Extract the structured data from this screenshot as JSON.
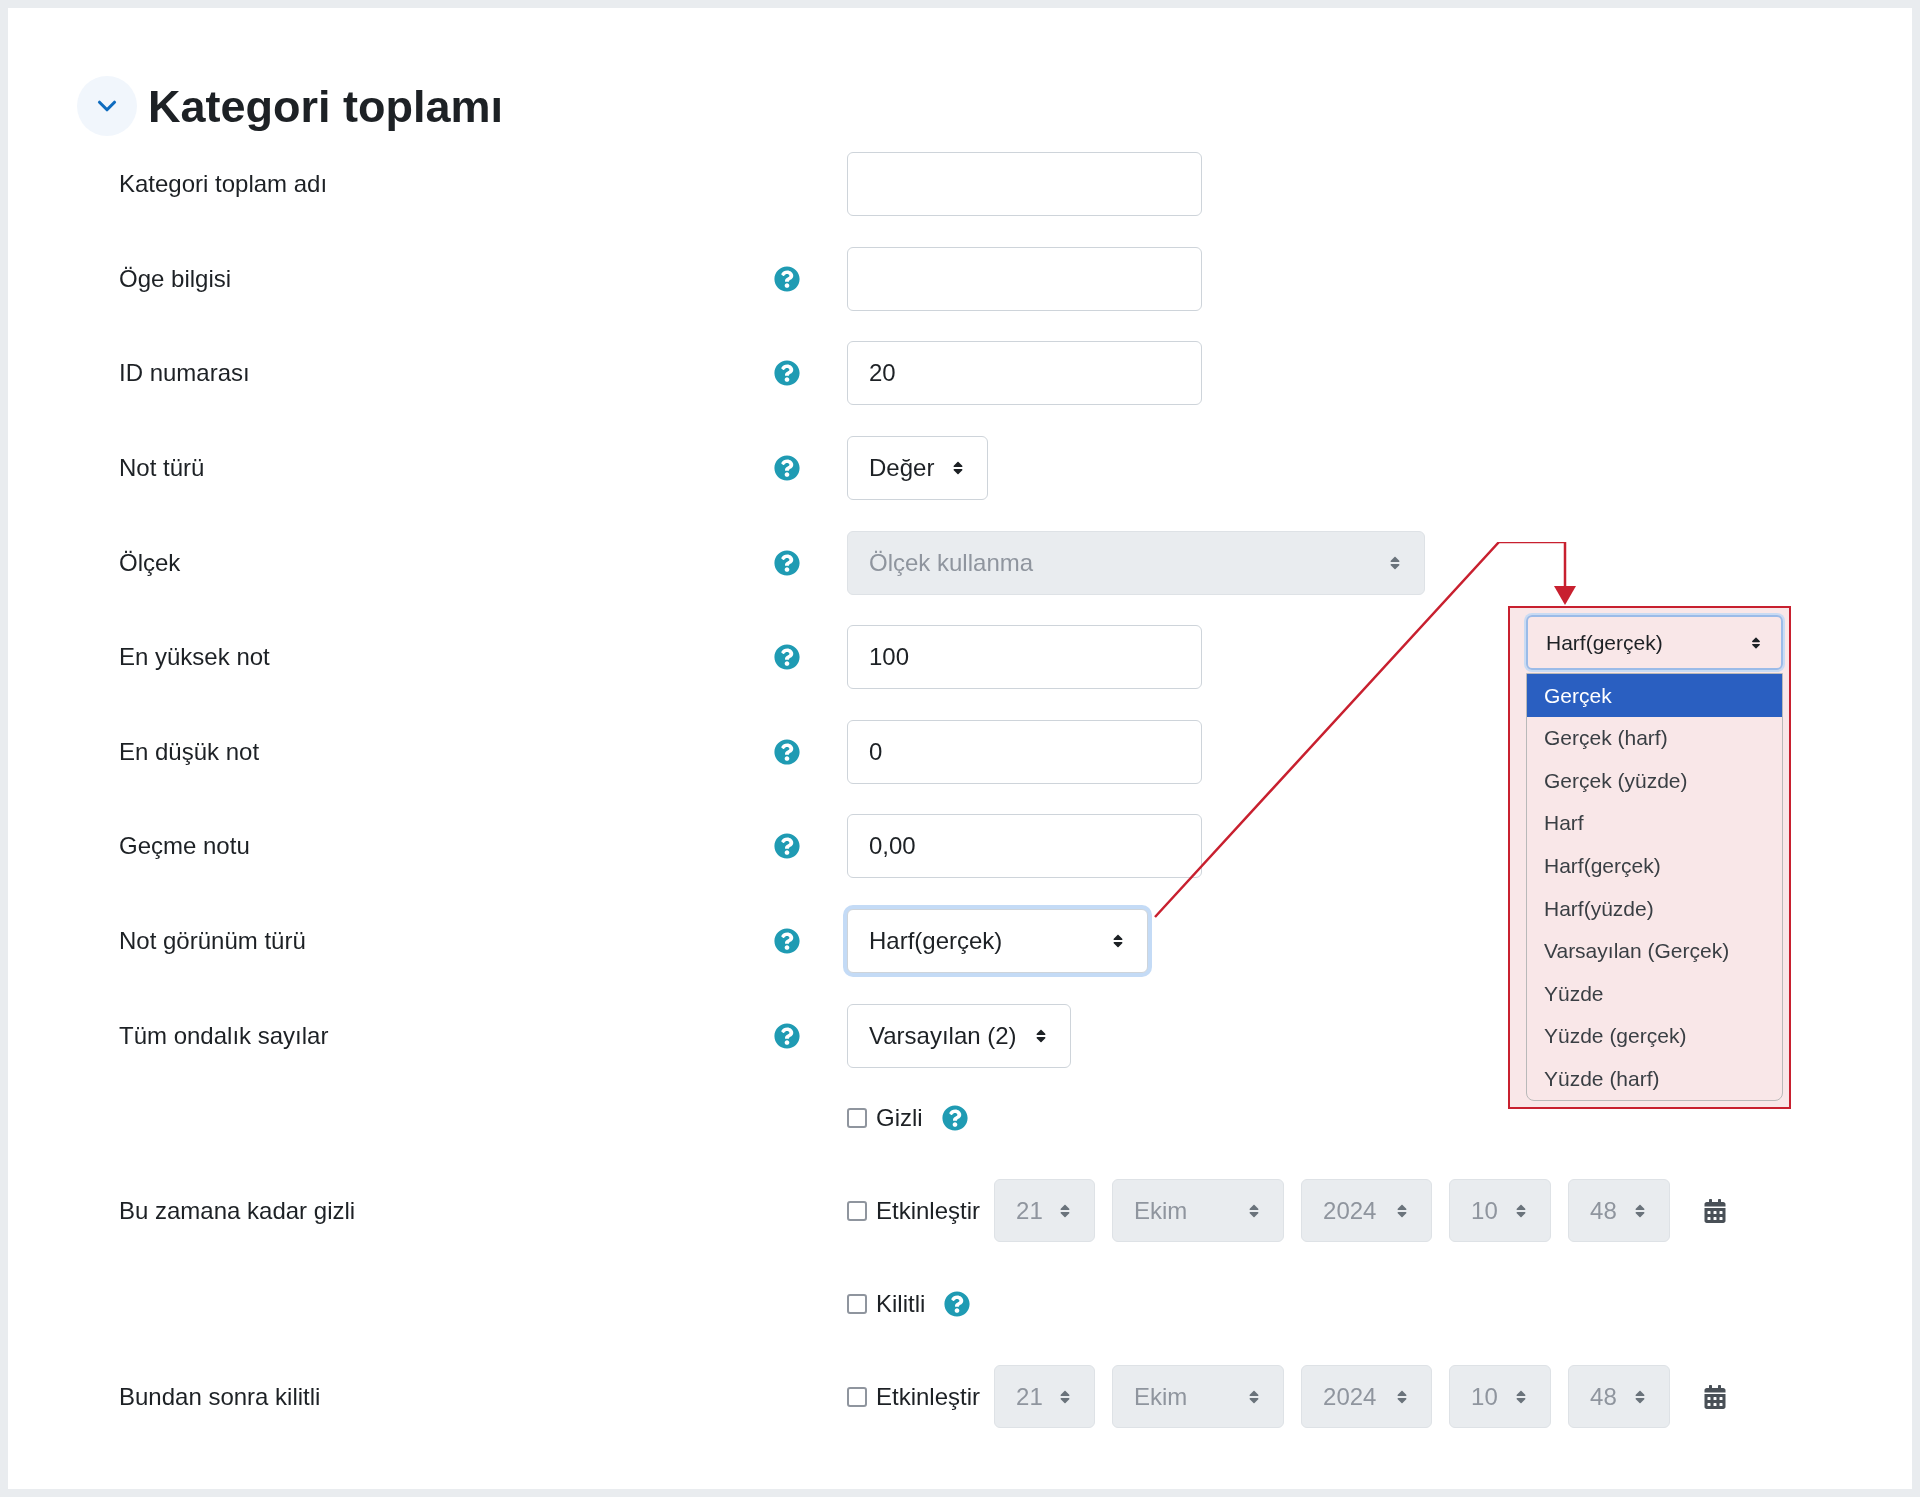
{
  "section": {
    "title": "Kategori toplamı",
    "expanded": true
  },
  "fields": [
    {
      "kind": "text",
      "label": "Kategori toplam adı",
      "help": false
    },
    {
      "kind": "text",
      "label": "Öge bilgisi",
      "help": true
    },
    {
      "kind": "text",
      "label": "ID numarası",
      "help": true,
      "value": "20"
    },
    {
      "kind": "select",
      "label": "Not türü",
      "help": true,
      "value": "Değer",
      "disabled": false,
      "focused": false
    },
    {
      "kind": "select",
      "label": "Ölçek",
      "help": true,
      "value": "Ölçek kullanma",
      "disabled": true,
      "focused": false
    },
    {
      "kind": "text",
      "label": "En yüksek not",
      "help": true,
      "value": "100"
    },
    {
      "kind": "text",
      "label": "En düşük not",
      "help": true,
      "value": "0"
    },
    {
      "kind": "text",
      "label": "Geçme notu",
      "help": true,
      "value": "0,00"
    },
    {
      "kind": "select",
      "label": "Not görünüm türü",
      "help": true,
      "value": "Harf(gerçek)",
      "disabled": false,
      "focused": true
    },
    {
      "kind": "select",
      "label": "Tüm ondalık sayılar",
      "help": true,
      "value": "Varsayılan (2)",
      "disabled": false,
      "focused": false
    },
    {
      "kind": "checkbox",
      "text": "Gizli",
      "checked": false,
      "help": true
    },
    {
      "kind": "datetime",
      "label": "Bu zamana kadar gizli",
      "enable_text": "Etkinleştir",
      "checked": false,
      "disabled": true,
      "parts": [
        "21",
        "Ekim",
        "2024",
        "10",
        "48"
      ]
    },
    {
      "kind": "checkbox",
      "text": "Kilitli",
      "checked": false,
      "help": true
    },
    {
      "kind": "datetime",
      "label": "Bundan sonra kilitli",
      "enable_text": "Etkinleştir",
      "checked": false,
      "disabled": true,
      "parts": [
        "21",
        "Ekim",
        "2024",
        "10",
        "48"
      ]
    }
  ],
  "callout": {
    "value": "Harf(gerçek)",
    "options": [
      {
        "label": "Gerçek",
        "highlighted": true
      },
      {
        "label": "Gerçek (harf)",
        "highlighted": false
      },
      {
        "label": "Gerçek (yüzde)",
        "highlighted": false
      },
      {
        "label": "Harf",
        "highlighted": false
      },
      {
        "label": "Harf(gerçek)",
        "highlighted": false
      },
      {
        "label": "Harf(yüzde)",
        "highlighted": false
      },
      {
        "label": "Varsayılan (Gerçek)",
        "highlighted": false
      },
      {
        "label": "Yüzde",
        "highlighted": false
      },
      {
        "label": "Yüzde (gerçek)",
        "highlighted": false
      },
      {
        "label": "Yüzde (harf)",
        "highlighted": false
      }
    ]
  }
}
